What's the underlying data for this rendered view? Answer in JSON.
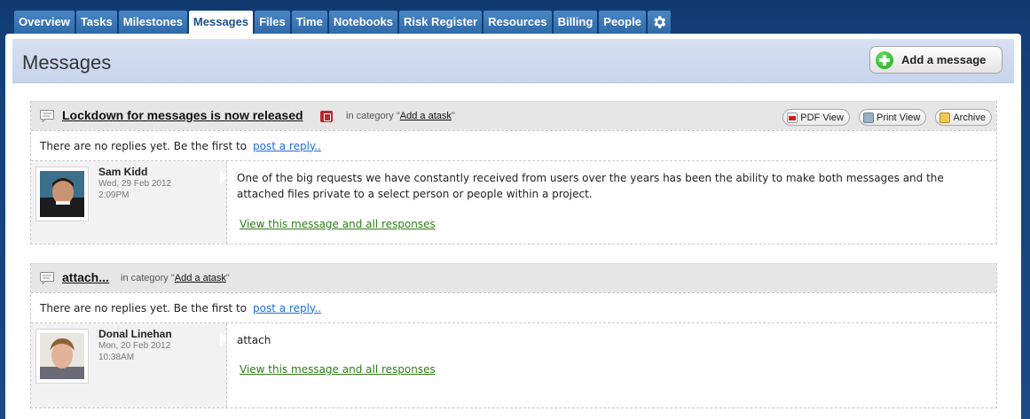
{
  "tabs": [
    {
      "label": "Overview"
    },
    {
      "label": "Tasks"
    },
    {
      "label": "Milestones"
    },
    {
      "label": "Messages",
      "active": true
    },
    {
      "label": "Files"
    },
    {
      "label": "Time"
    },
    {
      "label": "Notebooks"
    },
    {
      "label": "Risk Register"
    },
    {
      "label": "Resources"
    },
    {
      "label": "Billing"
    },
    {
      "label": "People"
    }
  ],
  "settings_icon": "gear-icon",
  "header": {
    "title": "Messages",
    "add_button_label": "Add a message"
  },
  "messages": [
    {
      "title": "Lockdown for messages is now released",
      "private": true,
      "category_prefix": "in category \"",
      "category": "Add a atask",
      "category_suffix": "\"",
      "actions": {
        "pdf": "PDF View",
        "print": "Print View",
        "archive": "Archive"
      },
      "no_replies_text": "There are no replies yet. Be the first to",
      "reply_link": "post a reply..",
      "author": {
        "name": "Sam Kidd",
        "date": "Wed, 29 Feb 2012",
        "time": "2:09PM"
      },
      "body": "One of the big requests we have constantly received from users over the years has been the ability to make both messages and the attached files private to a select person or people within a project.",
      "view_link": "View this message and all responses"
    },
    {
      "title": "attach...",
      "private": false,
      "category_prefix": "in category \"",
      "category": "Add a atask",
      "category_suffix": "\"",
      "no_replies_text": "There are no replies yet. Be the first to",
      "reply_link": "post a reply..",
      "author": {
        "name": "Donal Linehan",
        "date": "Mon, 20 Feb 2012",
        "time": "10:38AM"
      },
      "body": "attach",
      "view_link": "View this message and all responses"
    }
  ],
  "colors": {
    "page_bg": "#123f76",
    "tab_bg": "#3a77b8",
    "header_bg": "#ccd8ee",
    "link_blue": "#1a6ed8",
    "link_green": "#2e7d14",
    "lock_red": "#c0262d"
  }
}
